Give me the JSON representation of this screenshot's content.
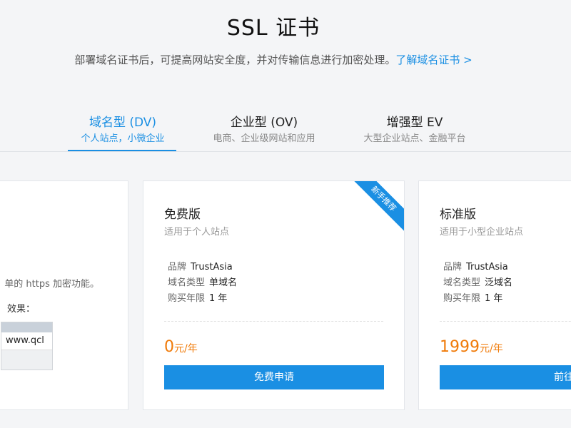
{
  "header": {
    "title": "SSL 证书",
    "subtitle": "部署域名证书后，可提高网站安全度，并对传输信息进行加密处理。",
    "learn_more": "了解域名证书 >"
  },
  "tabs": [
    {
      "label": "域名型 (DV)",
      "sub": "个人站点，小微企业",
      "active": true
    },
    {
      "label": "企业型 (OV)",
      "sub": "电商、企业级网站和应用",
      "active": false
    },
    {
      "label": "增强型 EV",
      "sub": "大型企业站点、金融平台",
      "active": false
    }
  ],
  "left_card": {
    "text1": "单的 https 加密功能。",
    "text2": "效果：",
    "url_text": "www.qcl"
  },
  "cards": [
    {
      "title": "免费版",
      "desc": "适用于个人站点",
      "ribbon": "新手推荐",
      "specs": [
        {
          "label": "品牌",
          "value": "TrustAsia"
        },
        {
          "label": "域名类型",
          "value": "单域名"
        },
        {
          "label": "购买年限",
          "value": "1 年"
        }
      ],
      "price": "0",
      "unit": "元/年",
      "button": "免费申请"
    },
    {
      "title": "标准版",
      "desc": "适用于小型企业站点",
      "specs": [
        {
          "label": "品牌",
          "value": "TrustAsia"
        },
        {
          "label": "域名类型",
          "value": "泛域名"
        },
        {
          "label": "购买年限",
          "value": "1 年"
        }
      ],
      "price": "1999",
      "unit": "元/年",
      "button": "前往选购"
    }
  ],
  "colors": {
    "accent": "#1a8fe3",
    "price": "#f07b0a",
    "background": "#f4f5f7"
  }
}
